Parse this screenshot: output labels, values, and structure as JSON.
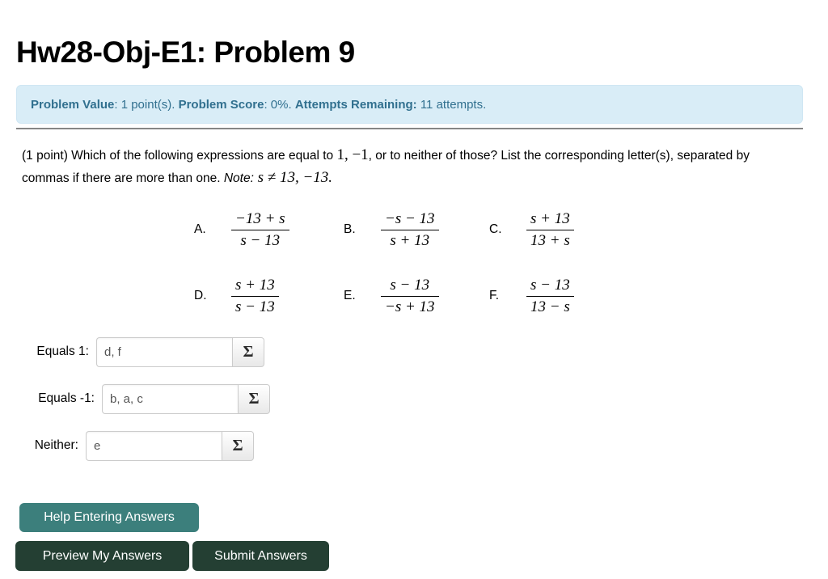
{
  "title": "Hw28-Obj-E1: Problem 9",
  "banner": {
    "value_label": "Problem Value",
    "value_text": ": 1 point(s). ",
    "score_label": "Problem Score",
    "score_text": ": 0%. ",
    "attempts_label": "Attempts Remaining:",
    "attempts_text": " 11 attempts."
  },
  "question": {
    "part1": "(1 point) Which of the following expressions are equal to ",
    "math1": "1, −1",
    "part2": ", or to neither of those? List the corresponding letter(s), separated by commas if there are more than one. ",
    "note_label": "Note:",
    "math2": " s ≠ 13, −13."
  },
  "choices": [
    {
      "letter": "A.",
      "numerator": "−13 + s",
      "denominator": "s − 13"
    },
    {
      "letter": "B.",
      "numerator": "−s − 13",
      "denominator": "s + 13"
    },
    {
      "letter": "C.",
      "numerator": "s + 13",
      "denominator": "13 + s"
    },
    {
      "letter": "D.",
      "numerator": "s + 13",
      "denominator": "s − 13"
    },
    {
      "letter": "E.",
      "numerator": "s − 13",
      "denominator": "−s + 13"
    },
    {
      "letter": "F.",
      "numerator": "s − 13",
      "denominator": "13 − s"
    }
  ],
  "answers": [
    {
      "label": "Equals 1:",
      "value": "d, f",
      "sigma": "Σ"
    },
    {
      "label": "Equals -1:",
      "value": "b, a, c",
      "sigma": "Σ"
    },
    {
      "label": "Neither:",
      "value": "e",
      "sigma": "Σ"
    }
  ],
  "buttons": {
    "help": "Help Entering Answers",
    "preview": "Preview My Answers",
    "submit": "Submit Answers"
  },
  "colors": {
    "banner_bg": "#d9edf7",
    "banner_text": "#31708f",
    "help_btn": "#3c7f7c",
    "action_btn": "#243f33",
    "divider": "#868686"
  }
}
